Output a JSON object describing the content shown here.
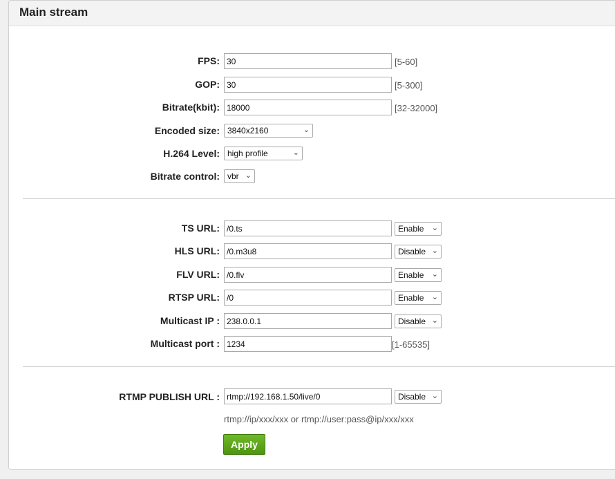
{
  "header": {
    "title": "Main stream"
  },
  "video": {
    "fps": {
      "label": "FPS:",
      "value": "30",
      "range": "[5-60]"
    },
    "gop": {
      "label": "GOP:",
      "value": "30",
      "range": "[5-300]"
    },
    "bitrate": {
      "label": "Bitrate(kbit):",
      "value": "18000",
      "range": "[32-32000]"
    },
    "encoded_size": {
      "label": "Encoded size:",
      "selected": "3840x2160"
    },
    "h264_level": {
      "label": "H.264 Level:",
      "selected": "high profile"
    },
    "bitrate_control": {
      "label": "Bitrate control:",
      "selected": "vbr"
    }
  },
  "urls": {
    "ts": {
      "label": "TS URL:",
      "value": "/0.ts",
      "state": "Enable"
    },
    "hls": {
      "label": "HLS URL:",
      "value": "/0.m3u8",
      "state": "Disable"
    },
    "flv": {
      "label": "FLV URL:",
      "value": "/0.flv",
      "state": "Enable"
    },
    "rtsp": {
      "label": "RTSP URL:",
      "value": "/0",
      "state": "Enable"
    },
    "multicast_ip": {
      "label": "Multicast IP :",
      "value": "238.0.0.1",
      "state": "Disable"
    },
    "multicast_port": {
      "label": "Multicast port :",
      "value": "1234",
      "range": "[1-65535]"
    }
  },
  "rtmp": {
    "label": "RTMP PUBLISH URL :",
    "value": "rtmp://192.168.1.50/live/0",
    "state": "Disable",
    "note": "rtmp://ip/xxx/xxx or rtmp://user:pass@ip/xxx/xxx"
  },
  "apply_label": "Apply"
}
